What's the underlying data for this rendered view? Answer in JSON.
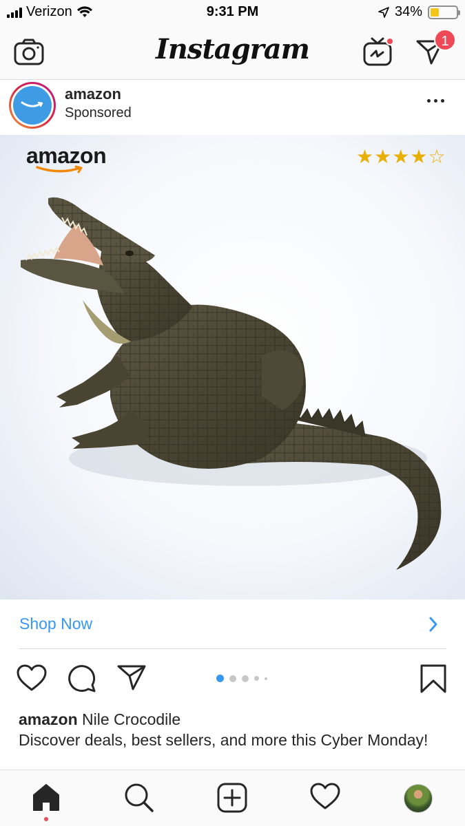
{
  "status_bar": {
    "carrier": "Verizon",
    "time": "9:31 PM",
    "battery_percent": "34%",
    "battery_level": 0.34
  },
  "top_nav": {
    "logo": "Instagram",
    "direct_badge_count": "1",
    "icons": [
      "camera-icon",
      "igtv-icon",
      "direct-message-icon"
    ]
  },
  "post": {
    "username": "amazon",
    "sponsored_label": "Sponsored",
    "media": {
      "brand_text": "amazon",
      "rating_stars": 4,
      "rating_max": 5
    },
    "cta_label": "Shop Now",
    "carousel": {
      "total_dots": 5,
      "active_index": 0
    },
    "caption": {
      "username": "amazon",
      "product": "Nile Crocodile",
      "text": "Discover deals, best sellers, and more this Cyber Monday!"
    }
  },
  "tab_bar": {
    "items": [
      "home-icon",
      "search-icon",
      "new-post-icon",
      "activity-icon",
      "profile-avatar"
    ]
  },
  "colors": {
    "link_blue": "#3897f0",
    "badge_red": "#ed4956",
    "amazon_blue": "#3f9be3",
    "star_gold": "#e8b007"
  }
}
